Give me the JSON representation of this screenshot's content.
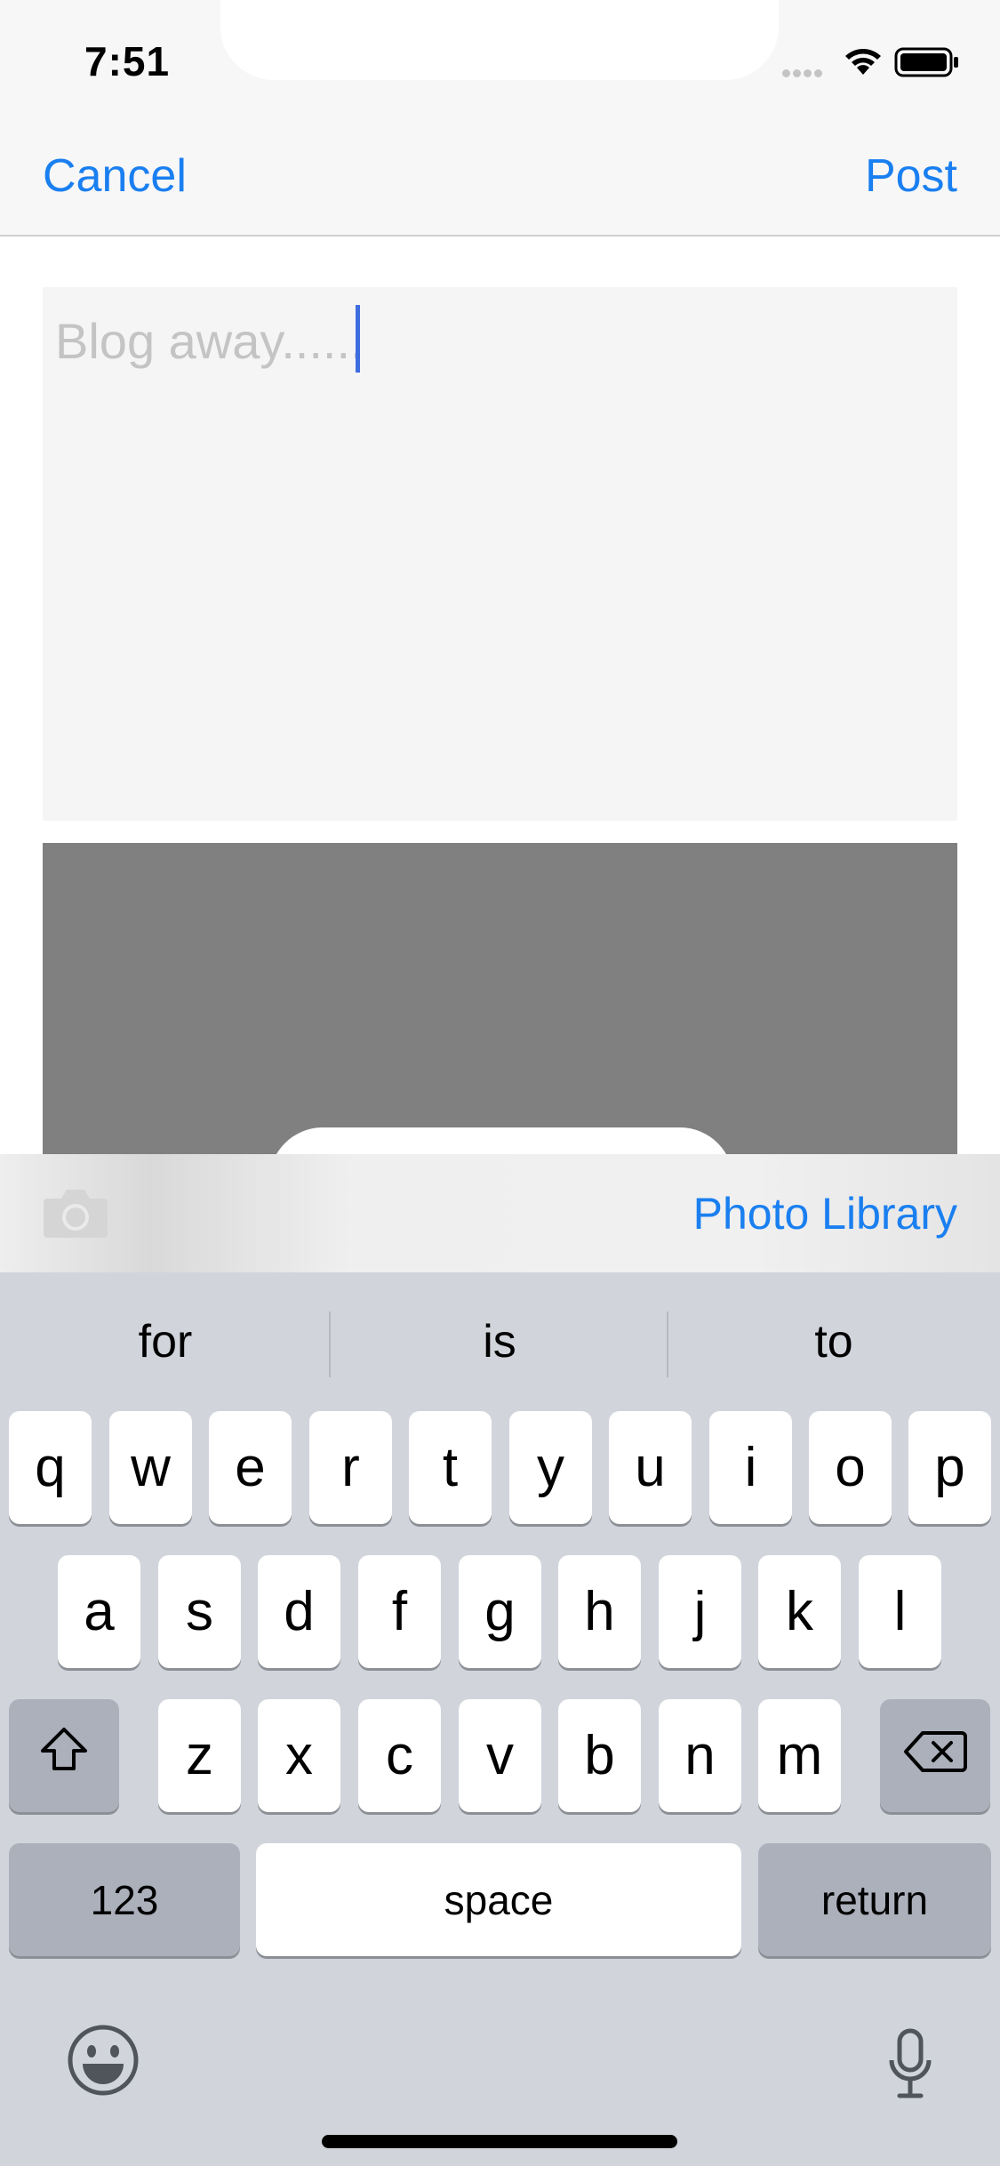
{
  "status_bar": {
    "time": "7:51"
  },
  "nav": {
    "cancel_label": "Cancel",
    "post_label": "Post"
  },
  "compose": {
    "placeholder": "Blog away......"
  },
  "accessory": {
    "camera_icon": "camera-icon",
    "photo_library_label": "Photo Library"
  },
  "keyboard": {
    "suggestions": [
      "for",
      "is",
      "to"
    ],
    "row1": [
      "q",
      "w",
      "e",
      "r",
      "t",
      "y",
      "u",
      "i",
      "o",
      "p"
    ],
    "row2": [
      "a",
      "s",
      "d",
      "f",
      "g",
      "h",
      "j",
      "k",
      "l"
    ],
    "row3": [
      "z",
      "x",
      "c",
      "v",
      "b",
      "n",
      "m"
    ],
    "numbers_label": "123",
    "space_label": "space",
    "return_label": "return",
    "icons": [
      "shift-icon",
      "delete-icon",
      "emoji-icon",
      "microphone-icon"
    ]
  },
  "colors": {
    "accent": "#1a7ff0",
    "keyboard_bg": "#d1d4db",
    "preview_gray": "#808080"
  }
}
